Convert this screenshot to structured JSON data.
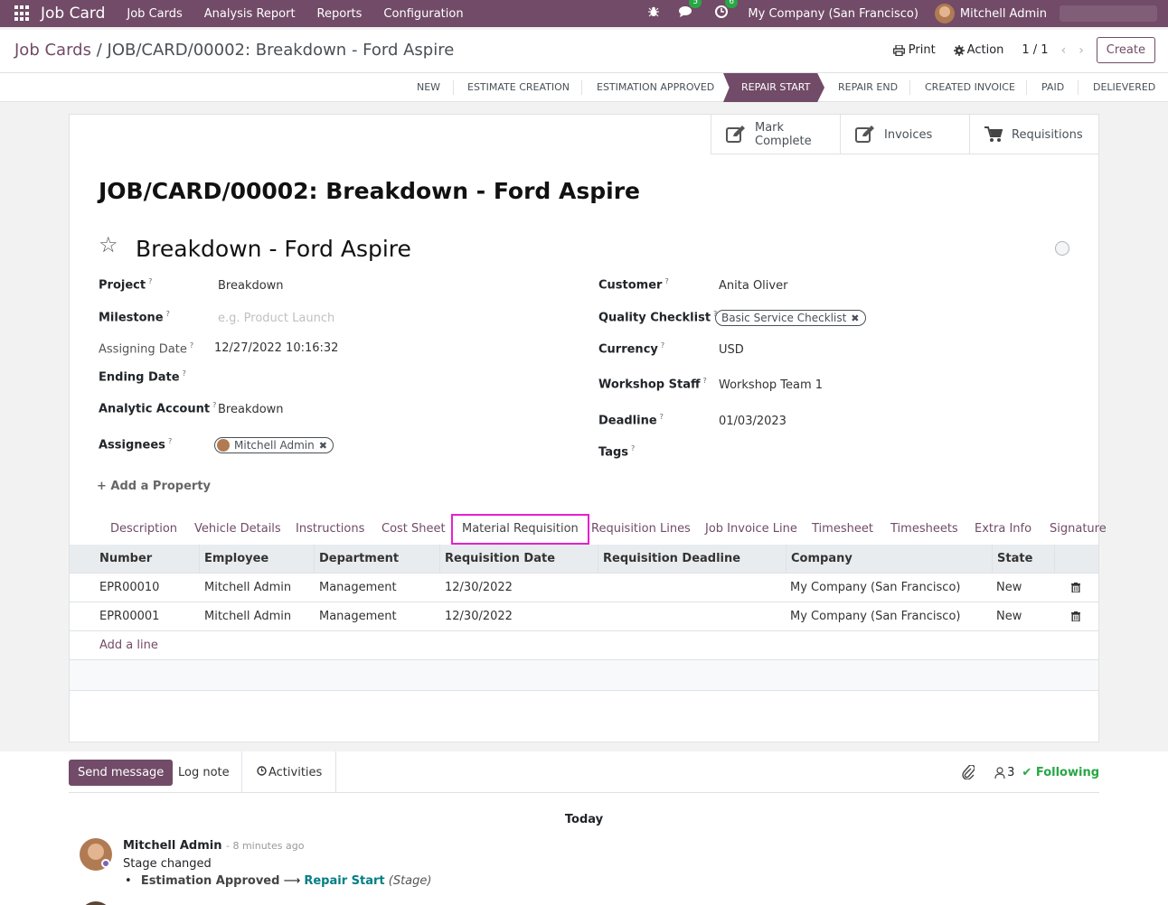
{
  "navbar": {
    "app_name": "Job Card",
    "menus": [
      "Job Cards",
      "Analysis Report",
      "Reports",
      "Configuration"
    ],
    "messages_count": "5",
    "activities_count": "6",
    "company": "My Company (San Francisco)",
    "user": "Mitchell Admin"
  },
  "breadcrumb": {
    "parent": "Job Cards",
    "separator": "/",
    "current": "JOB/CARD/00002: Breakdown - Ford Aspire"
  },
  "toolbar": {
    "print": "Print",
    "action": "Action",
    "pager": "1 / 1",
    "create": "Create"
  },
  "stages": [
    "NEW",
    "ESTIMATE CREATION",
    "ESTIMATION APPROVED",
    "REPAIR START",
    "REPAIR END",
    "CREATED INVOICE",
    "PAID",
    "DELIEVERED"
  ],
  "active_stage": "REPAIR START",
  "smart_buttons": {
    "mark_complete_1": "Mark",
    "mark_complete_2": "Complete",
    "invoices": "Invoices",
    "requisitions": "Requisitions"
  },
  "record": {
    "title": "JOB/CARD/00002: Breakdown - Ford Aspire",
    "name": "Breakdown - Ford Aspire"
  },
  "fields_left": {
    "project_label": "Project",
    "project": "Breakdown",
    "milestone_label": "Milestone",
    "milestone_placeholder": "e.g. Product Launch",
    "assigning_date_label": "Assigning Date",
    "assigning_date": "12/27/2022 10:16:32",
    "ending_date_label": "Ending Date",
    "analytic_account_label": "Analytic Account",
    "analytic_account": "Breakdown",
    "assignees_label": "Assignees",
    "assignee": "Mitchell Admin"
  },
  "fields_right": {
    "customer_label": "Customer",
    "customer": "Anita Oliver",
    "quality_checklist_label": "Quality Checklist",
    "quality_checklist": "Basic Service Checklist",
    "currency_label": "Currency",
    "currency": "USD",
    "workshop_staff_label": "Workshop Staff",
    "workshop_staff": "Workshop Team 1",
    "deadline_label": "Deadline",
    "deadline": "01/03/2023",
    "tags_label": "Tags"
  },
  "add_property": "Add a Property",
  "tabs": [
    "Description",
    "Vehicle Details",
    "Instructions",
    "Cost Sheet",
    "Material Requisition",
    "Requisition Lines",
    "Job Invoice Line",
    "Timesheet",
    "Timesheets",
    "Extra Info",
    "Signature"
  ],
  "active_tab": "Material Requisition",
  "table": {
    "columns": [
      "Number",
      "Employee",
      "Department",
      "Requisition Date",
      "Requisition Deadline",
      "Company",
      "State"
    ],
    "rows": [
      [
        "EPR00010",
        "Mitchell Admin",
        "Management",
        "12/30/2022",
        "",
        "My Company (San Francisco)",
        "New"
      ],
      [
        "EPR00001",
        "Mitchell Admin",
        "Management",
        "12/30/2022",
        "",
        "My Company (San Francisco)",
        "New"
      ]
    ],
    "add_line": "Add a line"
  },
  "chatter": {
    "send_message": "Send message",
    "log_note": "Log note",
    "activities": "Activities",
    "followers_count": "3",
    "following": "Following",
    "today": "Today",
    "message": {
      "author": "Mitchell Admin",
      "time": "- 8 minutes ago",
      "body": "Stage changed",
      "old_value": "Estimation Approved",
      "new_value": "Repair Start",
      "field": "(Stage)"
    }
  },
  "colors": {
    "brand": "#714B67",
    "success": "#28a745",
    "tab_highlight": "#e71fd0",
    "link_teal": "#017e84"
  }
}
